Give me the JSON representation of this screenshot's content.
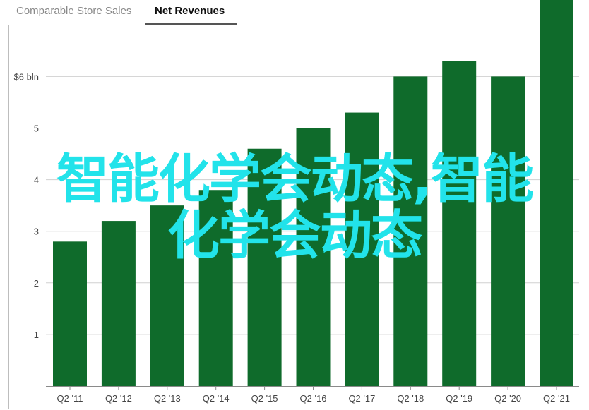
{
  "tabs": [
    {
      "label": "Comparable Store Sales",
      "active": false
    },
    {
      "label": "Net Revenues",
      "active": true
    }
  ],
  "overlay_text": {
    "line1": "智能化学会动态,智能",
    "line2": "化学会动态"
  },
  "colors": {
    "bar": "#0f6b2b",
    "overlay": "#22e3ea",
    "grid": "#d0d0d0"
  },
  "chart_data": {
    "type": "bar",
    "categories": [
      "Q2 '11",
      "Q2 '12",
      "Q2 '13",
      "Q2 '14",
      "Q2 '15",
      "Q2 '16",
      "Q2 '17",
      "Q2 '18",
      "Q2 '19",
      "Q2 '20",
      "Q2 '21"
    ],
    "values": [
      2.8,
      3.2,
      3.5,
      3.8,
      4.6,
      5.0,
      5.3,
      6.0,
      6.3,
      6.0,
      8.1
    ],
    "yticks": [
      {
        "value": 1,
        "label": "1"
      },
      {
        "value": 2,
        "label": "2"
      },
      {
        "value": 3,
        "label": "3"
      },
      {
        "value": 4,
        "label": "4"
      },
      {
        "value": 5,
        "label": "5"
      },
      {
        "value": 6,
        "label": "$6 bln"
      }
    ],
    "ylim": [
      0,
      8.25
    ],
    "grid": true
  }
}
